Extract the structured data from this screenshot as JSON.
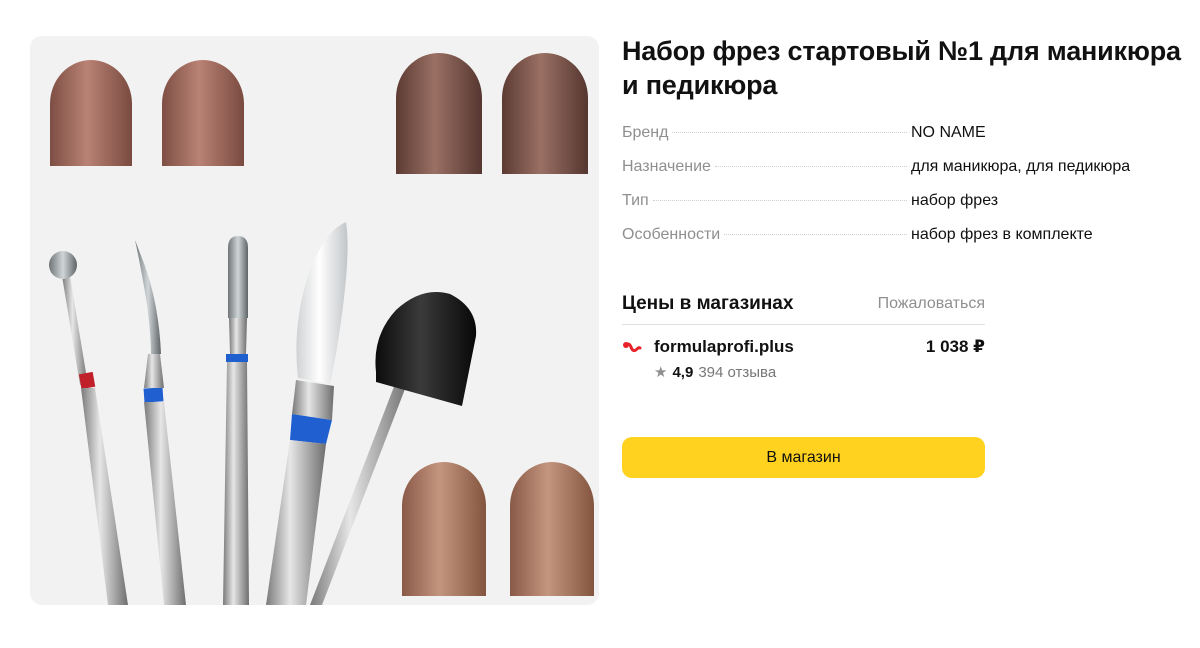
{
  "product": {
    "title": "Набор фрез стартовый №1 для маникюра и педикюра",
    "image_alt": "product-photo"
  },
  "specs": [
    {
      "label": "Бренд",
      "value": "NO NAME"
    },
    {
      "label": "Назначение",
      "value": "для маникюра, для педикюра"
    },
    {
      "label": "Тип",
      "value": "набор фрез"
    },
    {
      "label": "Особенности",
      "value": "набор фрез в комплекте"
    }
  ],
  "prices": {
    "title": "Цены в магазинах",
    "complain_label": "Пожаловаться",
    "offer": {
      "shop_name": "formulaprofi.plus",
      "shop_icon": "formulaprofi-logo-icon",
      "price": "1 038 ₽",
      "rating": "4,9",
      "reviews": "394 отзыва"
    },
    "button_label": "В магазин"
  },
  "colors": {
    "button": "#ffd21f",
    "muted_text": "#8f8f8f",
    "shop_logo": "#e8202a",
    "band_red": "#c0202a",
    "band_blue": "#1f5fd0"
  }
}
